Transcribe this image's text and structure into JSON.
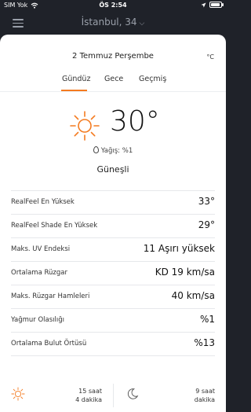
{
  "status_bar": {
    "carrier": "SIM Yok",
    "time": "ÖS 2:54",
    "battery_level": 0.9
  },
  "header": {
    "location": "İstanbul, 34",
    "menu_icon": "hamburger-menu-icon",
    "chevron_icon": "chevron-down-icon"
  },
  "date": "2 Temmuz Perşembe",
  "unit": "°C",
  "tabs": [
    {
      "label": "Gündüz",
      "active": true
    },
    {
      "label": "Gece",
      "active": false
    },
    {
      "label": "Geçmiş",
      "active": false
    }
  ],
  "current": {
    "temperature": "30°",
    "precip_label": "Yağış: %1",
    "condition": "Güneşli",
    "icon": "sun-icon"
  },
  "details": [
    {
      "label": "RealFeel En Yüksek",
      "value": "33°"
    },
    {
      "label": "RealFeel Shade En Yüksek",
      "value": "29°"
    },
    {
      "label": "Maks. UV Endeksi",
      "value": "11 Aşırı yüksek"
    },
    {
      "label": "Ortalama Rüzgar",
      "value": "KD 19 km/sa"
    },
    {
      "label": "Maks. Rüzgar Hamleleri",
      "value": "40 km/sa"
    },
    {
      "label": "Yağmur Olasılığı",
      "value": "%1"
    },
    {
      "label": "Ortalama Bulut Örtüsü",
      "value": "%13"
    }
  ],
  "bottom": {
    "sun_hours": "15 saat",
    "sun_minutes": "4 dakika",
    "moon_hours": "9 saat",
    "moon_minutes": "dakika"
  },
  "colors": {
    "accent": "#f47b20",
    "header_bg": "#1f2229",
    "card_bg": "#ffffff"
  }
}
